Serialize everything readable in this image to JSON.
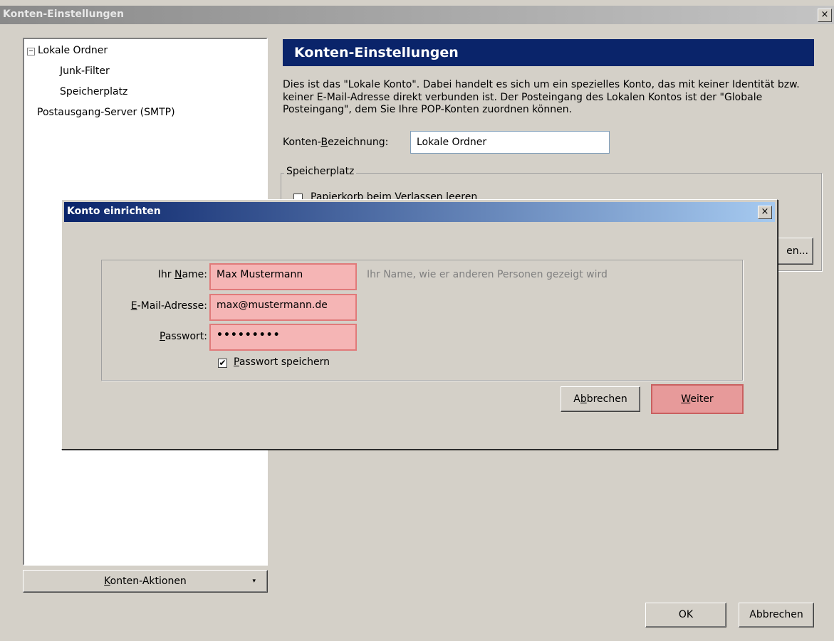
{
  "window": {
    "title": "Konten-Einstellungen",
    "close": "×"
  },
  "tree": {
    "expander": "−",
    "items": [
      {
        "label": "Lokale Ordner"
      },
      {
        "label": "Junk-Filter"
      },
      {
        "label": "Speicherplatz"
      },
      {
        "label": "Postausgang-Server (SMTP)"
      }
    ]
  },
  "accountActions": {
    "label_pre": "",
    "label_u": "K",
    "label_post": "onten-Aktionen",
    "arrow": "▾"
  },
  "panel": {
    "header": "Konten-Einstellungen",
    "description": "Dies ist das \"Lokale Konto\". Dabei handelt es sich um ein spezielles Konto, das mit keiner Identität bzw. keiner E-Mail-Adresse direkt verbunden ist. Der Posteingang des Lokalen Kontos ist der \"Globale Posteingang\", dem Sie Ihre POP-Konten zuordnen können.",
    "accountName": {
      "label_pre": "Konten-",
      "label_u": "B",
      "label_post": "ezeichnung:",
      "value": "Lokale Ordner"
    },
    "storage": {
      "legend": "Speicherplatz",
      "emptyTrash": "Papierkorb beim Verlassen leeren",
      "partialButton": "en..."
    }
  },
  "footer": {
    "ok": "OK",
    "cancel": "Abbrechen"
  },
  "dialog": {
    "title": "Konto einrichten",
    "close": "×",
    "name": {
      "label_pre": "Ihr ",
      "label_u": "N",
      "label_post": "ame:",
      "value": "Max Mustermann",
      "hint": "Ihr Name, wie er anderen Personen gezeigt wird"
    },
    "email": {
      "label_pre": "",
      "label_u": "E",
      "label_post": "-Mail-Adresse:",
      "value": "max@mustermann.de"
    },
    "password": {
      "label_pre": "",
      "label_u": "P",
      "label_post": "asswort:",
      "value": "•••••••••"
    },
    "savePassword": {
      "checked": true,
      "mark": "✔",
      "label_pre": "",
      "label_u": "P",
      "label_post": "asswort speichern"
    },
    "cancel": {
      "label_pre": "A",
      "label_u": "b",
      "label_post": "brechen"
    },
    "next": {
      "label_pre": "",
      "label_u": "W",
      "label_post": "eiter"
    }
  },
  "colors": {
    "headerBand": "#0a246a",
    "highlight": "#f5b5b5",
    "highlightBorder": "#e07a7a",
    "background": "#d4d0c8"
  }
}
